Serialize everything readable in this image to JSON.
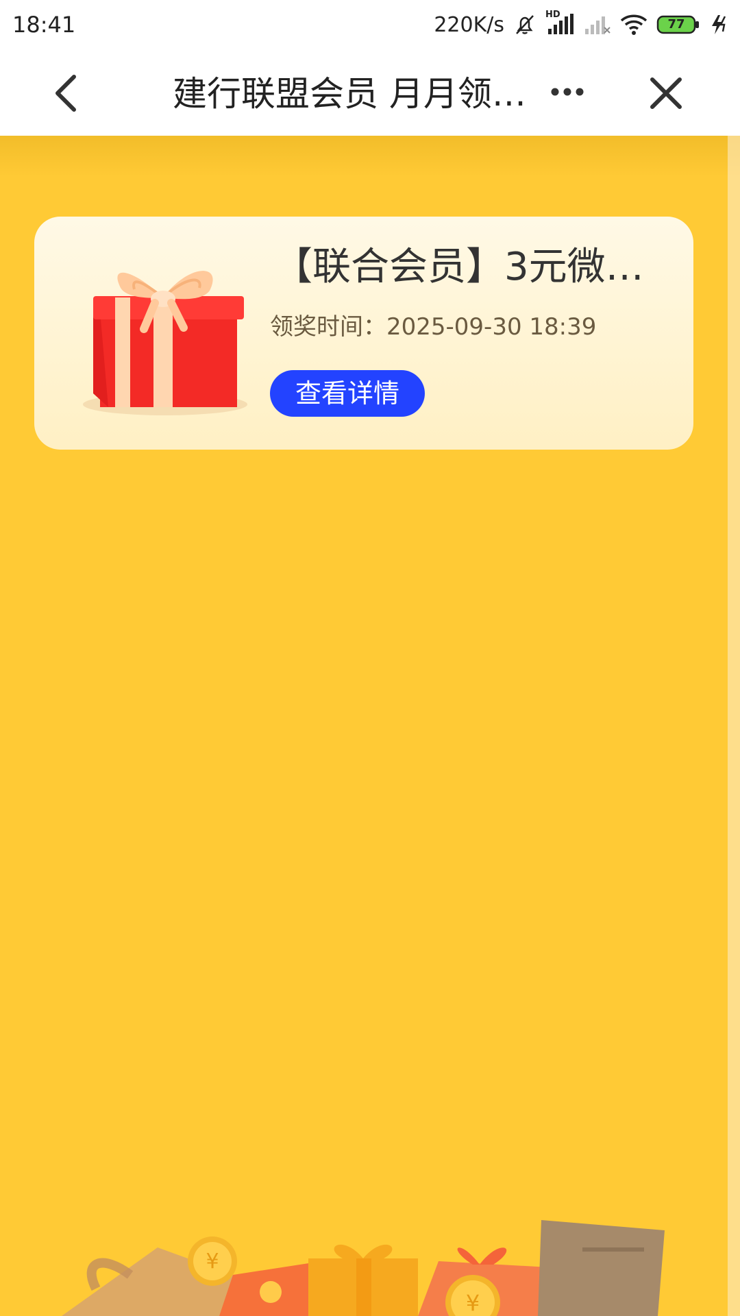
{
  "status_bar": {
    "time": "18:41",
    "net_speed": "220K/s",
    "hd_label": "HD",
    "battery": "77",
    "icons": [
      "mute-bell-icon",
      "hd-signal-icon",
      "no-signal-icon",
      "wifi-icon",
      "battery-icon",
      "charging-icon"
    ]
  },
  "title_bar": {
    "title": "建行联盟会员 月月领…",
    "icons": [
      "back-arrow-icon",
      "more-dots-icon",
      "close-icon"
    ]
  },
  "prize_card": {
    "name": "【联合会员】3元微…",
    "time_label": "领奖时间：2025-09-30 18:39",
    "detail_button": "查看详情",
    "image": "gift-box-icon"
  },
  "colors": {
    "background": "#FFCA35",
    "button": "#2343FF",
    "card": "#FFF6DA"
  }
}
